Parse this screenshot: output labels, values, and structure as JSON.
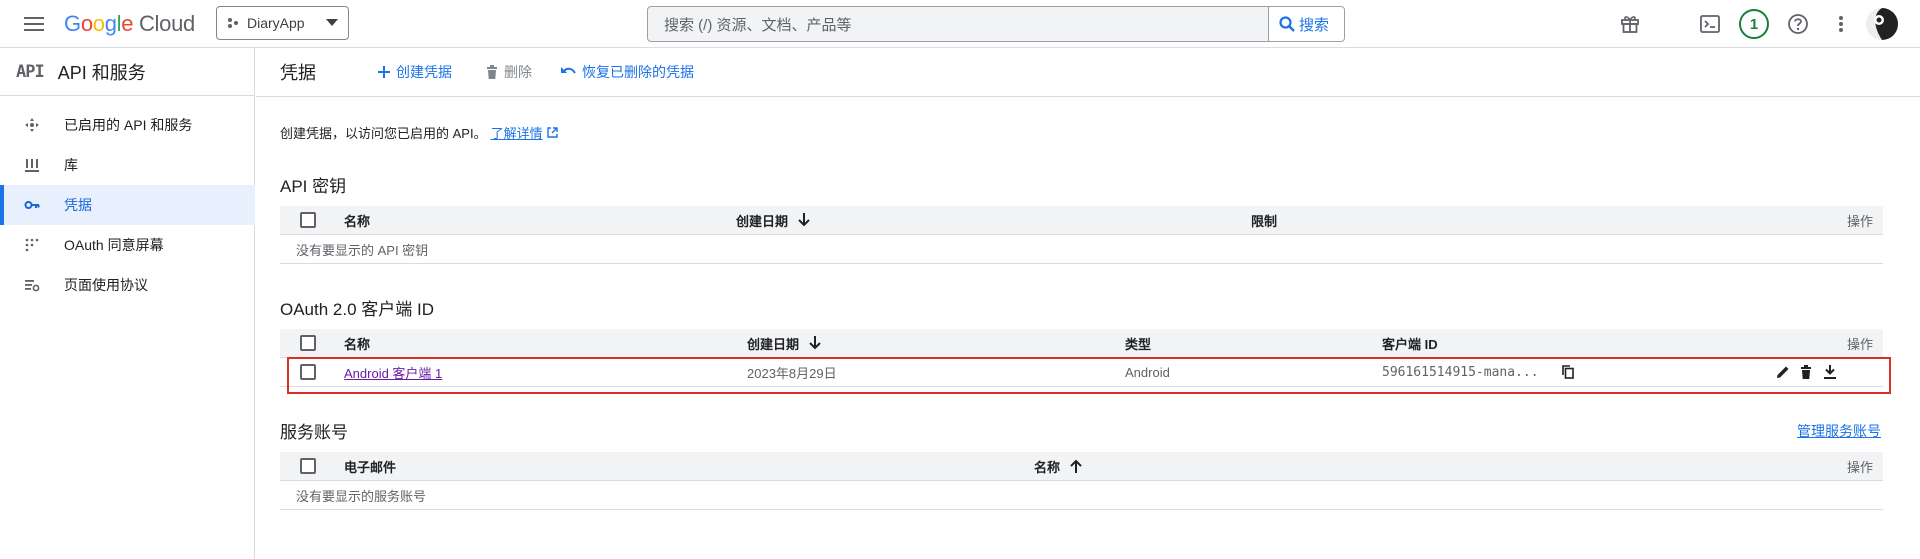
{
  "header": {
    "logo_google": "Google",
    "logo_cloud": "Cloud",
    "project_name": "DiaryApp",
    "search_placeholder": "搜索 (/) 资源、文档、产品等",
    "search_button": "搜索",
    "notification_count": "1"
  },
  "sidebar": {
    "title": "API 和服务",
    "items": [
      {
        "label": "已启用的 API 和服务",
        "icon": "api-hub-icon"
      },
      {
        "label": "库",
        "icon": "library-icon"
      },
      {
        "label": "凭据",
        "icon": "key-icon",
        "active": true
      },
      {
        "label": "OAuth 同意屏幕",
        "icon": "consent-icon"
      },
      {
        "label": "页面使用协议",
        "icon": "settings-list-icon"
      }
    ]
  },
  "page": {
    "title": "凭据",
    "create_label": "创建凭据",
    "delete_label": "删除",
    "restore_label": "恢复已删除的凭据",
    "intro_text": "创建凭据，以访问您已启用的 API。",
    "learn_more": "了解详情"
  },
  "api_keys": {
    "title": "API 密钥",
    "columns": [
      "名称",
      "创建日期",
      "限制",
      "操作"
    ],
    "empty_text": "没有要显示的 API 密钥"
  },
  "oauth": {
    "title": "OAuth 2.0 客户端 ID",
    "columns": [
      "名称",
      "创建日期",
      "类型",
      "客户端 ID",
      "操作"
    ],
    "rows": [
      {
        "name": "Android 客户端 1",
        "date": "2023年8月29日",
        "type": "Android",
        "client_id": "596161514915-mana..."
      }
    ]
  },
  "service_accounts": {
    "title": "服务账号",
    "manage_link": "管理服务账号",
    "columns": [
      "电子邮件",
      "名称",
      "操作"
    ],
    "empty_text": "没有要显示的服务账号"
  },
  "colors": {
    "accent": "#1a73e8",
    "highlight_border": "#d93025",
    "link_visited": "#681da8",
    "badge_green": "#188038"
  }
}
